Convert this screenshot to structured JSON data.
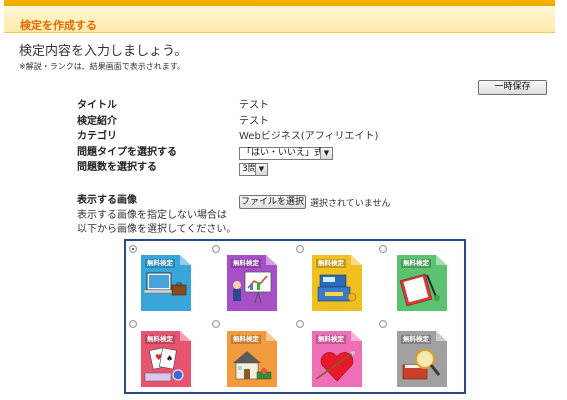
{
  "header": {
    "title": "検定を作成する"
  },
  "intro": {
    "heading": "検定内容を入力しましょう。",
    "note": "※解説・ランクは、結果画面で表示されます。"
  },
  "toolbar": {
    "save_label": "一時保存"
  },
  "form": {
    "title_label": "タイトル",
    "title_value": "テスト",
    "desc_label": "検定紹介",
    "desc_value": "テスト",
    "category_label": "カテゴリ",
    "category_value": "Webビジネス(アフィリエイト)",
    "qtype_label": "問題タイプを選択する",
    "qtype_value": "「はい・いいえ」式",
    "qcount_label": "問題数を選択する",
    "qcount_value": "3問"
  },
  "image": {
    "label": "表示する画像",
    "file_button": "ファイルを選択",
    "file_status": "選択されていません",
    "help_line1": "表示する画像を指定しない場合は",
    "help_line2": "以下から画像を選択してください。"
  },
  "tiles": [
    {
      "badge": "無料検定",
      "icon": "laptop-briefcase-icon",
      "color": "#38a6d8",
      "selected": true
    },
    {
      "badge": "無料検定",
      "icon": "presentation-chart-icon",
      "color": "#a74fc8",
      "selected": false
    },
    {
      "badge": "無料検定",
      "icon": "cash-register-icon",
      "color": "#f0c020",
      "selected": false
    },
    {
      "badge": "無料検定",
      "icon": "notebook-pen-icon",
      "color": "#5cc170",
      "selected": false
    },
    {
      "badge": "無料検定",
      "icon": "casino-chips-icon",
      "color": "#e85470",
      "selected": false
    },
    {
      "badge": "無料検定",
      "icon": "house-icon",
      "color": "#f39a3c",
      "selected": false
    },
    {
      "badge": "無料検定",
      "icon": "heart-arrow-icon",
      "color": "#ef6fb6",
      "selected": false
    },
    {
      "badge": "無料検定",
      "icon": "book-magnifier-icon",
      "color": "#a0a0a0",
      "selected": false
    }
  ]
}
